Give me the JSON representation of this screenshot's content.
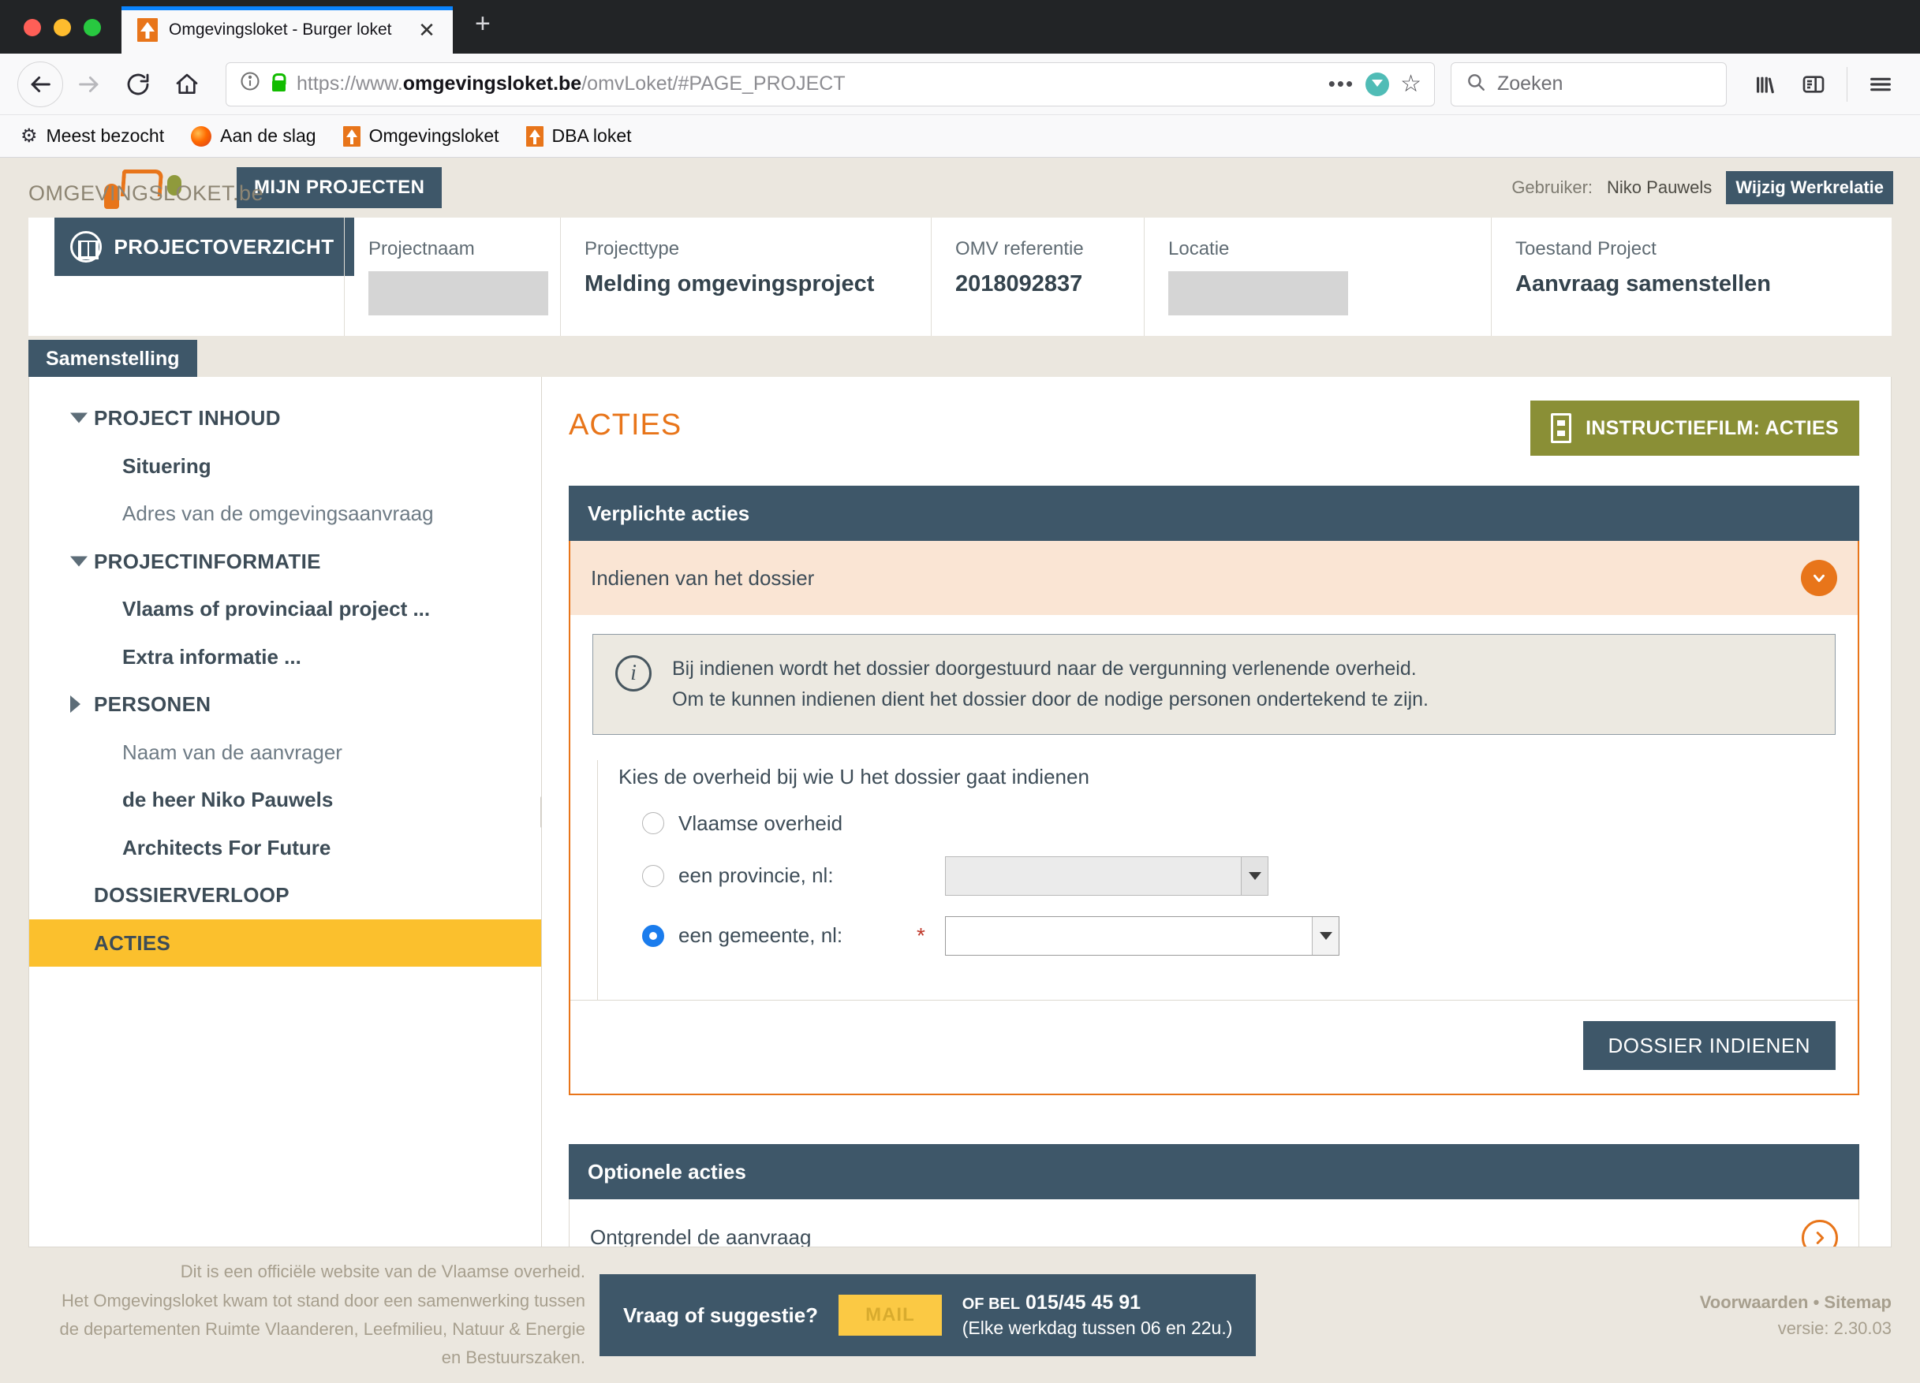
{
  "browser": {
    "tab": {
      "title": "Omgevingsloket - Burger loket",
      "favicon": "house-icon",
      "close": "✕"
    },
    "new_tab": "+",
    "url": {
      "prefix": "https://www.",
      "host": "omgevingsloket.be",
      "path": "/omvLoket/#PAGE_PROJECT"
    },
    "search_placeholder": "Zoeken",
    "bookmarks": [
      {
        "label": "Meest bezocht",
        "icon": "gear-icon"
      },
      {
        "label": "Aan de slag",
        "icon": "firefox-icon"
      },
      {
        "label": "Omgevingsloket",
        "icon": "omgevingsloket-icon"
      },
      {
        "label": "DBA loket",
        "icon": "omgevingsloket-icon"
      }
    ]
  },
  "app": {
    "logo_text": "OMGEVINGSLOKET.be",
    "mijn_projecten": "MIJN PROJECTEN",
    "user_label": "Gebruiker:",
    "user_name": "Niko Pauwels",
    "wijzig_werkrelatie": "Wijzig Werkrelatie",
    "projectoverzicht": "PROJECTOVERZICHT",
    "project_fields": [
      {
        "label": "Projectnaam",
        "value": "",
        "masked": true
      },
      {
        "label": "Projecttype",
        "value": "Melding omgevingsproject",
        "masked": false
      },
      {
        "label": "OMV referentie",
        "value": "2018092837",
        "masked": false
      },
      {
        "label": "Locatie",
        "value": "",
        "masked": true
      },
      {
        "label": "Toestand Project",
        "value": "Aanvraag samenstellen",
        "masked": false
      }
    ],
    "tab_samenstelling": "Samenstelling"
  },
  "sidebar": {
    "items": [
      {
        "label": "PROJECT INHOUD",
        "type": "group",
        "expanded": true
      },
      {
        "label": "Situering",
        "type": "child"
      },
      {
        "label": "Adres van de omgevingsaanvraag",
        "type": "child-muted"
      },
      {
        "label": "PROJECTINFORMATIE",
        "type": "group",
        "expanded": true
      },
      {
        "label": "Vlaams of provinciaal project ...",
        "type": "child"
      },
      {
        "label": "Extra informatie ...",
        "type": "child"
      },
      {
        "label": "PERSONEN",
        "type": "group",
        "expanded": false
      },
      {
        "label": "Naam van de aanvrager",
        "type": "child-muted"
      },
      {
        "label": "de heer Niko Pauwels",
        "type": "child"
      },
      {
        "label": "Architects For Future",
        "type": "child"
      },
      {
        "label": "DOSSIERVERLOOP",
        "type": "group-plain"
      },
      {
        "label": "ACTIES",
        "type": "group-active"
      }
    ]
  },
  "main": {
    "title": "ACTIES",
    "instructiefilm": "INSTRUCTIEFILM: ACTIES",
    "verplichte_acties": {
      "header": "Verplichte acties",
      "accordion_title": "Indienen van het dossier",
      "info_line1": "Bij indienen wordt het dossier doorgestuurd naar de vergunning verlenende overheid.",
      "info_line2": "Om te kunnen indienen dient het dossier door de nodige personen ondertekend te zijn.",
      "legend": "Kies de overheid bij wie U het dossier gaat indienen",
      "options": [
        {
          "label": "Vlaamse overheid",
          "selected": false,
          "has_select": false,
          "required": false,
          "select_value": ""
        },
        {
          "label": "een provincie, nl:",
          "selected": false,
          "has_select": true,
          "required": false,
          "select_value": "",
          "disabled": true
        },
        {
          "label": "een gemeente, nl:",
          "selected": true,
          "has_select": true,
          "required": true,
          "select_value": "",
          "disabled": false
        }
      ],
      "submit_button": "DOSSIER INDIENEN"
    },
    "optionele_acties": {
      "header": "Optionele acties",
      "rows": [
        {
          "label": "Ontgrendel de aanvraag"
        }
      ]
    }
  },
  "footer": {
    "disclaimer_lines": [
      "Dit is een officiële website van de Vlaamse overheid.",
      "Het Omgevingsloket kwam tot stand door een samenwerking tussen",
      "de departementen Ruimte Vlaanderen, Leefmilieu, Natuur & Energie",
      "en Bestuurszaken."
    ],
    "contact_question": "Vraag of suggestie?",
    "mail_button": "MAIL",
    "phone_line1_prefix": "OF BEL",
    "phone_line1_number": "015/45 45 91",
    "phone_line2": "(Elke werkdag tussen 06 en 22u.)",
    "links": "Voorwaarden • Sitemap",
    "version": "versie: 2.30.03"
  },
  "colors": {
    "accent_orange": "#e8751a",
    "dark_blue": "#3e5769",
    "yellow": "#fbc02d",
    "olive": "#8a8f36",
    "beige": "#ebe7df"
  }
}
